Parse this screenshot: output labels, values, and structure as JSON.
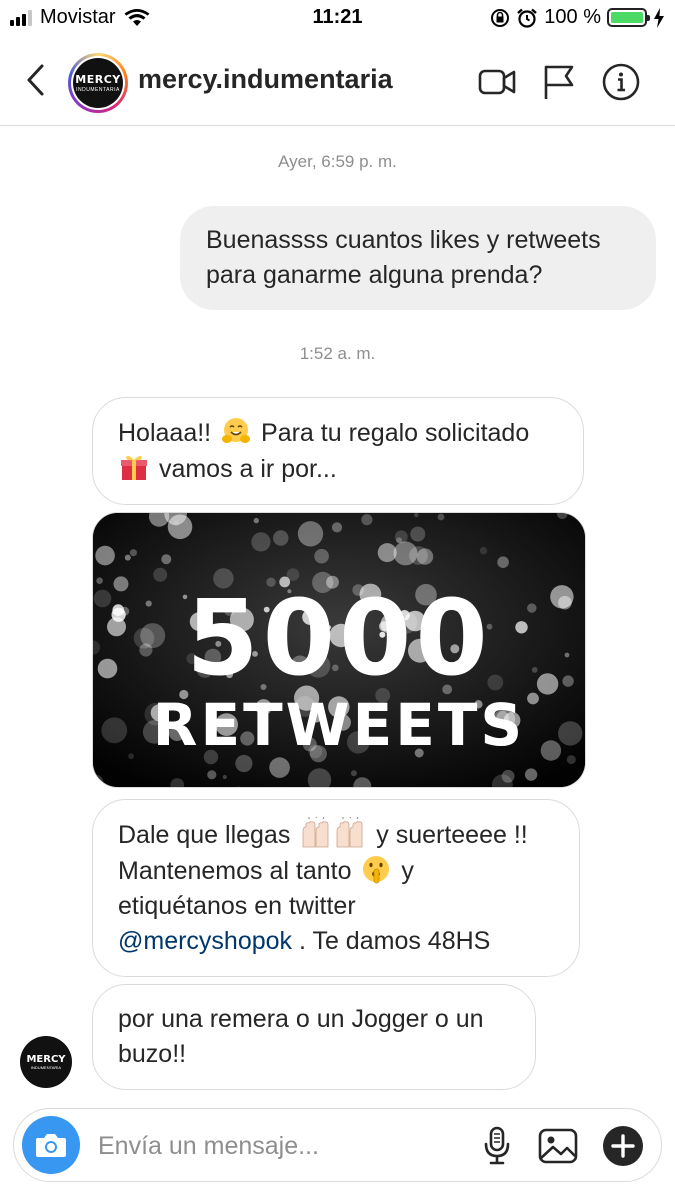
{
  "status_bar": {
    "carrier": "Movistar",
    "time": "11:21",
    "battery_percent": "100 %",
    "battery_level": 1.0,
    "signal_bars": 3
  },
  "header": {
    "username": "mercy.indumentaria",
    "avatar_brand": "MERCY",
    "avatar_sub": "INDUMENTARIA"
  },
  "messages": [
    {
      "type": "timestamp",
      "text": "Ayer, 6:59 p. m."
    },
    {
      "type": "sent",
      "lines": [
        "Buenassss cuantos likes y retweets",
        "para ganarme alguna prenda?"
      ]
    },
    {
      "type": "timestamp",
      "text": "1:52 a. m."
    },
    {
      "type": "received",
      "lines": [
        "Holaaa!!",
        "Para tu regalo solicitado",
        "vamos a ir por..."
      ],
      "emojis": [
        "hugging-face-emoji",
        "gift-emoji"
      ]
    },
    {
      "type": "image",
      "big_text": "5000",
      "small_text": "RETWEETS"
    },
    {
      "type": "received",
      "lines": [
        "Dale que llegas",
        "y suerteeee !!",
        "Mantenemos al tanto",
        "y",
        "etiquétanos en twitter",
        "@mercyshopok",
        ". Te damos 48HS"
      ],
      "emojis": [
        "raising-hands-emoji",
        "shushing-face-emoji"
      ]
    },
    {
      "type": "received",
      "lines": [
        "por una remera o un Jogger o un",
        "buzo!!"
      ]
    }
  ],
  "composer": {
    "placeholder": "Envía un mensaje..."
  },
  "colors": {
    "accent_blue": "#3897f0",
    "mention": "#00376b",
    "battery_green": "#4cd964",
    "sent_bubble": "#efefef",
    "border": "#dbdbdb"
  },
  "icons": [
    "back-arrow-icon",
    "video-call-icon",
    "flag-icon",
    "info-icon",
    "camera-icon",
    "microphone-icon",
    "gallery-icon",
    "plus-icon",
    "wifi-icon",
    "alarm-icon",
    "rotation-lock-icon",
    "charging-icon"
  ]
}
